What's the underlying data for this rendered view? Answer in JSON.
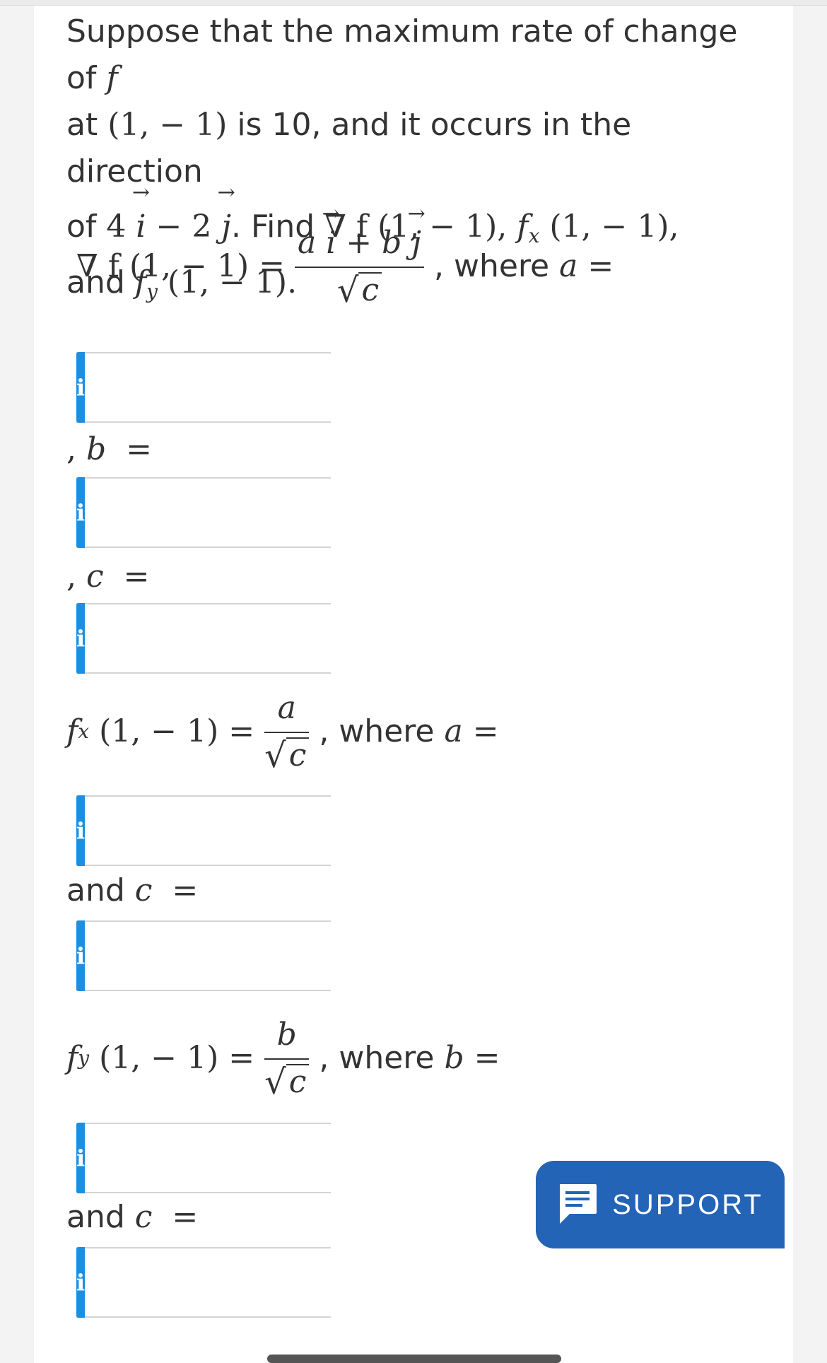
{
  "problem": {
    "intro": "Suppose that the maximum rate of change of",
    "f": "f",
    "at": "at",
    "point": "(1,  − 1)",
    "is_text": "is 10, and it occurs in the direction",
    "of": "of",
    "coef1": "4",
    "i": "i",
    "minus2": "− 2",
    "j": "j",
    "find": ". Find",
    "grad_f": "∇ f",
    "sep1": ",",
    "fx": "f",
    "x": "x",
    "sep2": ",",
    "and": "and",
    "fy": "f",
    "y": "y",
    "end": ".",
    "arrow": "→"
  },
  "row1": {
    "lhs": "∇ f (1,  − 1)  =",
    "num_a": "a",
    "num_i": "i",
    "num_plus": "+",
    "num_b": "b",
    "num_j": "j",
    "den_c": "c",
    "where_text": ", where",
    "var": "a",
    "eq": "="
  },
  "label_b": {
    "comma": ",",
    "var": "b",
    "eq": "="
  },
  "label_c": {
    "comma": ",",
    "var": "c",
    "eq": "="
  },
  "row2": {
    "f": "f",
    "sub": "x",
    "args": "(1,  − 1)  =",
    "num": "a",
    "den": "c",
    "where_text": ", where",
    "var": "a",
    "eq": "="
  },
  "label_and_c1": {
    "text": "and",
    "var": "c",
    "eq": "="
  },
  "row3": {
    "f": "f",
    "sub": "y",
    "args": "(1,  − 1)  =",
    "num": "b",
    "den": "c",
    "where_text": ", where",
    "var": "b",
    "eq": "="
  },
  "label_and_c2": {
    "text": "and",
    "var": "c",
    "eq": "="
  },
  "info_icon": "i",
  "inputs": {
    "v1": "",
    "v2": "",
    "v3": "",
    "v4": "",
    "v5": "",
    "v6": "",
    "v7": ""
  },
  "support": {
    "label": "SUPPORT"
  },
  "colors": {
    "info": "#1c8fe3",
    "support": "#2364b6"
  }
}
